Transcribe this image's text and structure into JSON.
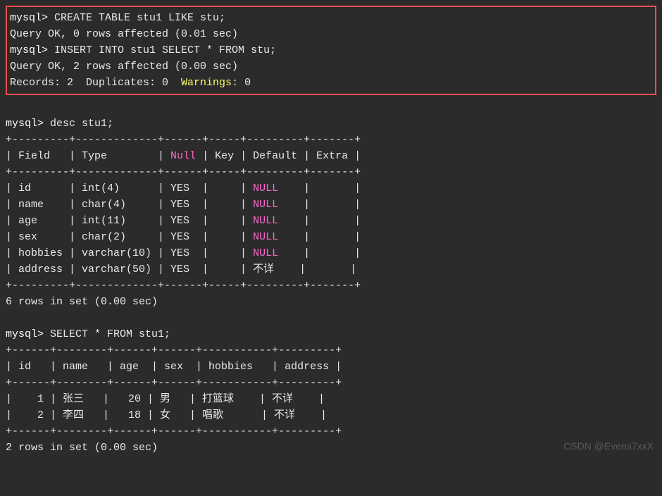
{
  "box": {
    "line1_prompt": "mysql>",
    "line1_rest": " CREATE TABLE stu1 LIKE stu;",
    "line2": "Query OK, 0 rows affected (0.01 sec)",
    "blank": "",
    "line3_prompt": "mysql>",
    "line3_rest": " INSERT INTO stu1 SELECT * FROM stu;",
    "line4": "Query OK, 2 rows affected (0.00 sec)",
    "line5_a": "Records: 2  Duplicates: 0  ",
    "line5_b": "Warnings",
    "line5_c": ": 0"
  },
  "desc_cmd_prompt": "mysql>",
  "desc_cmd_rest": " desc stu1;",
  "border1": "+---------+-------------+------+-----+---------+-------+",
  "header_a": "| Field   | Type        | ",
  "header_null": "Null",
  "header_b": " | Key | Default | Extra |",
  "rows": [
    {
      "pre": "| id      | int(4)      | YES  |     | ",
      "null": "NULL",
      "post": "    |       |"
    },
    {
      "pre": "| name    | char(4)     | YES  |     | ",
      "null": "NULL",
      "post": "    |       |"
    },
    {
      "pre": "| age     | int(11)     | YES  |     | ",
      "null": "NULL",
      "post": "    |       |"
    },
    {
      "pre": "| sex     | char(2)     | YES  |     | ",
      "null": "NULL",
      "post": "    |       |"
    },
    {
      "pre": "| hobbies | varchar(10) | YES  |     | ",
      "null": "NULL",
      "post": "    |       |"
    },
    {
      "pre": "| address | varchar(50) | YES  |     | 不详    |       |",
      "null": "",
      "post": ""
    }
  ],
  "border2": "+---------+-------------+------+-----+---------+-------+",
  "rows_summary": "6 rows in set (0.00 sec)",
  "select_cmd_prompt": "mysql>",
  "select_cmd_rest": " SELECT * FROM stu1;",
  "sborder1": "+------+--------+------+------+-----------+---------+",
  "sheader": "| id   | name   | age  | sex  | hobbies   | address |",
  "sborder2": "+------+--------+------+------+-----------+---------+",
  "srow1": "|    1 | 张三   |   20 | 男   | 打篮球    | 不详    |",
  "srow2": "|    2 | 李四   |   18 | 女   | 唱歌      | 不详    |",
  "sborder3": "+------+--------+------+------+-----------+---------+",
  "srows_summary": "2 rows in set (0.00 sec)",
  "watermark": "CSDN @Evens7xxX"
}
